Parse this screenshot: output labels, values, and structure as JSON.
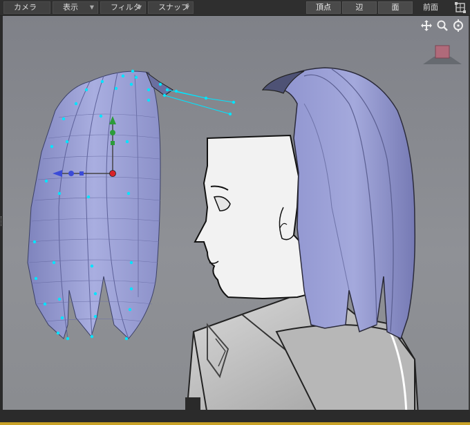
{
  "toolbar": {
    "menus": [
      "カメラ",
      "表示",
      "フィルタ",
      "スナップ"
    ],
    "modes": [
      "頂点",
      "辺",
      "面"
    ],
    "view_name": "前面"
  },
  "icons": {
    "view_cube": "view-cube-icon",
    "pan": "pan-move-icon",
    "zoom": "zoom-magnifier-icon",
    "orbit": "orbit-rotate-icon",
    "gizmo": "axis-orientation-gizmo-icon"
  },
  "colors": {
    "hair": "#9ea3d6",
    "hair_shadow": "#7f84bd",
    "vertex": "#00e5ff",
    "gizmo_x": "#3b4bd8",
    "gizmo_y": "#2c9c3a",
    "gizmo_center": "#d8232a",
    "viewport_bg": "#87898e",
    "status_accent": "#c9a227"
  }
}
